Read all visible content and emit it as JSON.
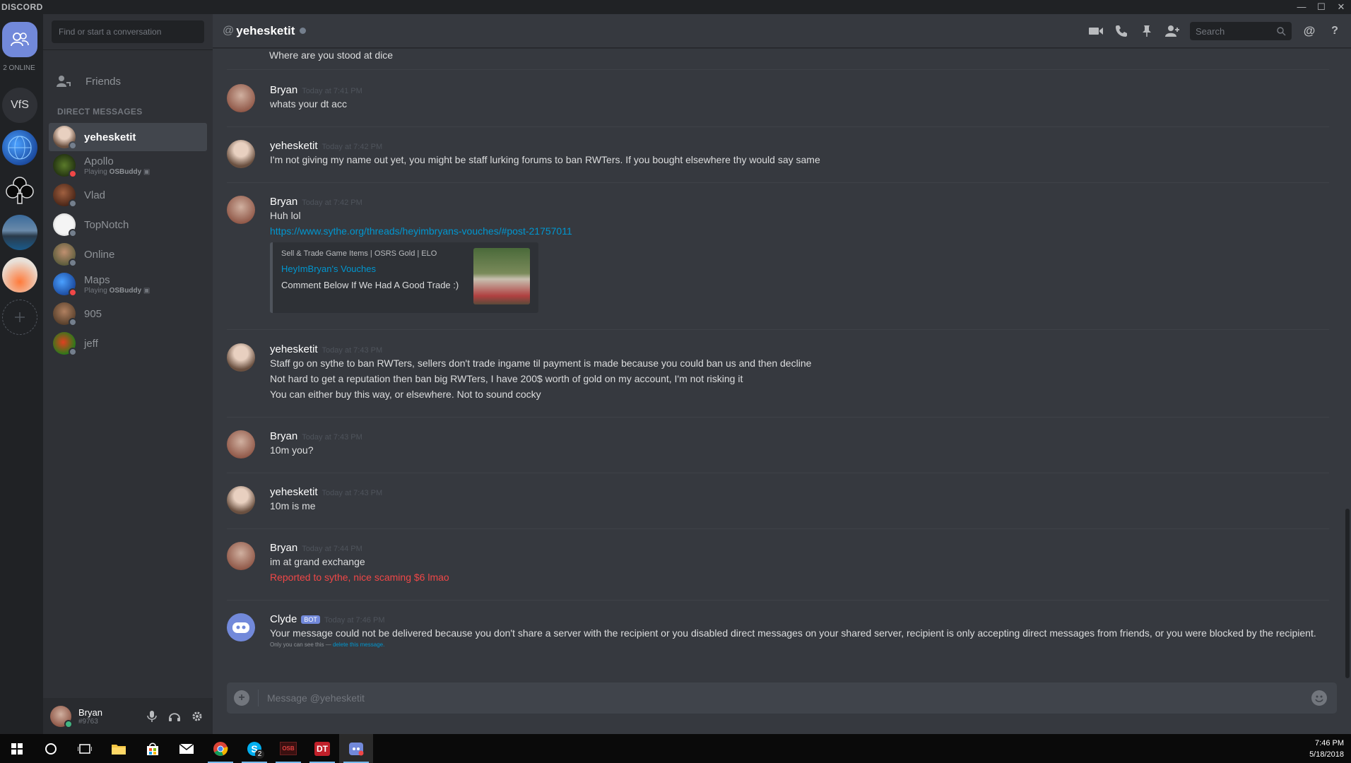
{
  "window": {
    "brand": "DISCORD",
    "controls": [
      "—",
      "☐",
      "✕"
    ]
  },
  "guilds": {
    "online_count": "2 ONLINE",
    "items": [
      {
        "label": "VfS"
      }
    ]
  },
  "dm_panel": {
    "search_placeholder": "Find or start a conversation",
    "friends_label": "Friends",
    "direct_messages_header": "DIRECT MESSAGES",
    "items": [
      {
        "name": "yehesketit",
        "sub": "",
        "status_color": "#747f8d",
        "avatar_color": "#8a6e5a"
      },
      {
        "name": "Apollo",
        "sub_prefix": "Playing ",
        "sub_game": "OSBuddy",
        "status_color": "#f04747",
        "avatar_color": "#2a3a1a"
      },
      {
        "name": "Vlad",
        "sub": "",
        "status_color": "#747f8d",
        "avatar_color": "#5a3020"
      },
      {
        "name": "TopNotch",
        "sub": "",
        "status_color": "#747f8d",
        "avatar_color": "#d8d8d8"
      },
      {
        "name": "Online",
        "sub": "",
        "status_color": "#747f8d",
        "avatar_color": "#6a7a4a"
      },
      {
        "name": "Maps",
        "sub_prefix": "Playing ",
        "sub_game": "OSBuddy",
        "status_color": "#f04747",
        "avatar_color": "#1a4a9a"
      },
      {
        "name": "905",
        "sub": "",
        "status_color": "#747f8d",
        "avatar_color": "#7a5a3a"
      },
      {
        "name": "jeff",
        "sub": "",
        "status_color": "#747f8d",
        "avatar_color": "#4a8a2a"
      }
    ]
  },
  "user_panel": {
    "username": "Bryan",
    "tag": "#9763"
  },
  "chat": {
    "at_symbol": "@",
    "title": "yehesketit",
    "search_placeholder": "Search",
    "top_partial_line": "Where are you stood at dice",
    "messages": [
      {
        "author": "Bryan",
        "time": "Today at 7:41 PM",
        "lines": [
          "whats your dt acc"
        ]
      },
      {
        "author": "yehesketit",
        "time": "Today at 7:42 PM",
        "lines": [
          "I'm not giving my name out yet, you might be staff lurking forums to ban RWTers. If you bought elsewhere thy would say same"
        ]
      },
      {
        "author": "Bryan",
        "time": "Today at 7:42 PM",
        "lines": [
          "Huh lol"
        ],
        "link": "https://www.sythe.org/threads/heyimbryans-vouches/#post-21757011",
        "embed": {
          "provider": "Sell & Trade Game Items | OSRS Gold | ELO",
          "title": "HeyImBryan's Vouches",
          "description": "Comment Below If We Had A Good Trade :)"
        }
      },
      {
        "author": "yehesketit",
        "time": "Today at 7:43 PM",
        "lines": [
          "Staff go on sythe to ban RWTers, sellers don't trade ingame til payment is made because you could ban us and then decline",
          "Not hard to get a reputation then ban big RWTers, I have 200$ worth of gold on my account, I'm not risking it",
          "You can either buy this way, or elsewhere. Not to sound cocky"
        ]
      },
      {
        "author": "Bryan",
        "time": "Today at 7:43 PM",
        "lines": [
          "10m you?"
        ]
      },
      {
        "author": "yehesketit",
        "time": "Today at 7:43 PM",
        "lines": [
          "10m is me"
        ]
      },
      {
        "author": "Bryan",
        "time": "Today at 7:44 PM",
        "lines": [
          "im at grand exchange"
        ],
        "red_line": "Reported to sythe, nice scaming $6 lmao"
      },
      {
        "author": "Clyde",
        "bot_tag": "BOT",
        "time": "Today at 7:46 PM",
        "lines": [
          "Your message could not be delivered because you don't share a server with the recipient or you disabled direct messages on your shared server, recipient is only accepting direct messages from friends, or you were blocked by the recipient."
        ],
        "ephemeral_note": "Only you can see this — ",
        "ephemeral_link": "delete this message."
      }
    ],
    "composer_placeholder": "Message @yehesketit"
  },
  "taskbar": {
    "skype_badge": "2",
    "obb_label": "OSB",
    "dt_label": "DT",
    "time": "7:46 PM",
    "date": "5/18/2018"
  },
  "colors": {
    "blurple": "#7289da",
    "link": "#0096cf",
    "red": "#f04747"
  }
}
